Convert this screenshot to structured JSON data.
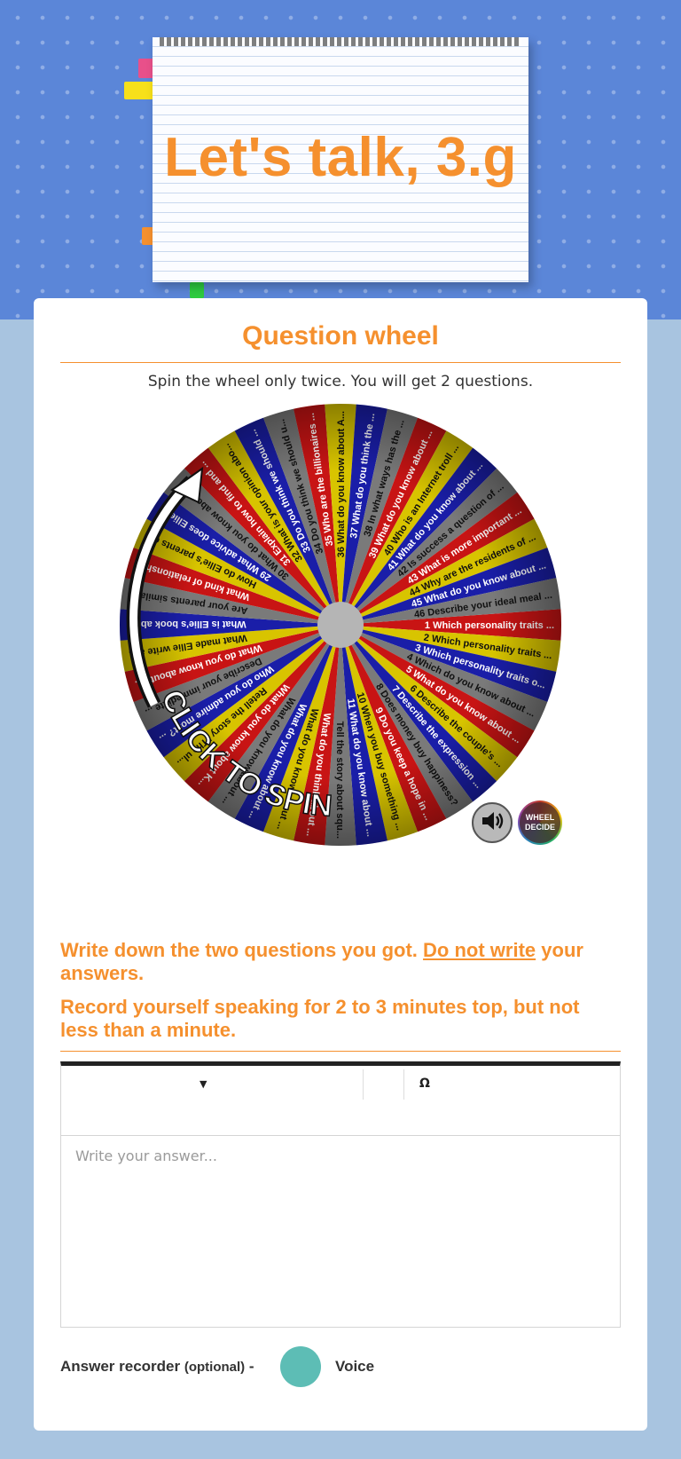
{
  "header": {
    "title": "Let's talk, 3.g"
  },
  "section": {
    "title": "Question wheel",
    "instructions": "Spin the wheel only twice. You will get 2 questions."
  },
  "wheel": {
    "spin_label": "CLICK TO SPIN",
    "logo_line1": "WHEEL",
    "logo_line2": "DECIDE",
    "colors": [
      "#c81414",
      "#d8c400",
      "#1a1ea8",
      "#7a7a7a"
    ],
    "segments": [
      "1 Which personality traits ...",
      "2 Which personality traits ...",
      "3 Which personality traits o...",
      "4 Which do you know about ...",
      "5 What do you know about ...",
      "6 Describe the couple's ...",
      "7 Describe the expression ...",
      "8 Does money buy happiness?",
      "9 Do you keep a hope in ...",
      "10 When you buy something ...",
      "11 What do you know about ...",
      "Tell the story about squ...",
      "What do you think about ...",
      "What do you know about ...",
      "What do you know about ...",
      "What do you know about ...",
      "What do you know about K...",
      "Retell the story \"The ul...",
      "Who do you admire most? ...",
      "Describe your immediate ...",
      "What do you know about a...",
      "What made Ellie write a ...",
      "What is Ellie's book abo...",
      "Are your parents similar...",
      "What kind of relationshi...",
      "How do Ellie's parents d...",
      "29 What advice does Ellie ...",
      "30 What do you know about t...",
      "31 Explain how to find and ...",
      "32 What is your opinion abo...",
      "33 Do you think we should ...",
      "34 Do you think we should u...",
      "35 Who are the billionaires ...",
      "36 What do you know about A...",
      "37 What do you think the ...",
      "38 In what ways has the ...",
      "39 What do you know about ...",
      "40 Who is an Internet troll ...",
      "41 What do you know about ...",
      "42 Is success a question of ...",
      "43 What is more important ...",
      "44 Why are the residents of ...",
      "45 What do you know about ...",
      "46 Describe your ideal meal ..."
    ]
  },
  "task": {
    "line1_prefix": "Write down the two questions you got.",
    "line1_underlined": "Do not write",
    "line1_suffix": "your answers.",
    "line2": "Record yourself speaking for 2 to 3 minutes top, but not less than a minute."
  },
  "editor": {
    "omega": "Ω",
    "placeholder": "Write your answer..."
  },
  "recorder": {
    "label": "Answer recorder",
    "optional": "(optional)",
    "dash": "-",
    "voice": "Voice"
  }
}
